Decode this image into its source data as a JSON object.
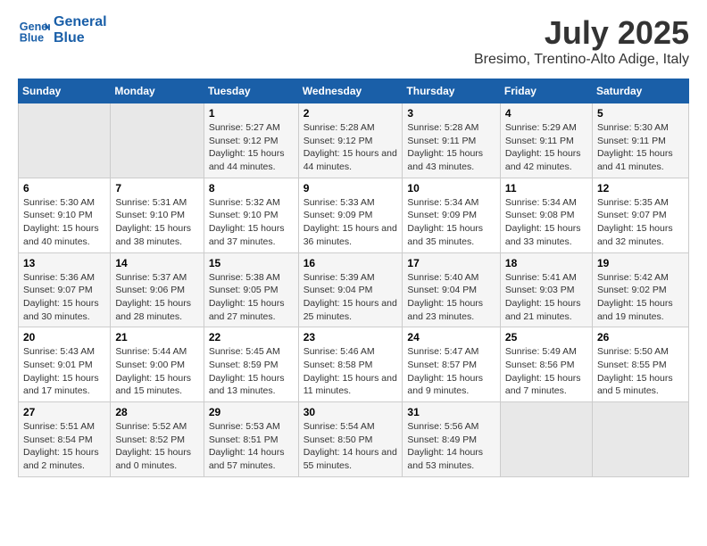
{
  "header": {
    "logo_line1": "General",
    "logo_line2": "Blue",
    "main_title": "July 2025",
    "subtitle": "Bresimo, Trentino-Alto Adige, Italy"
  },
  "days_of_week": [
    "Sunday",
    "Monday",
    "Tuesday",
    "Wednesday",
    "Thursday",
    "Friday",
    "Saturday"
  ],
  "weeks": [
    [
      {
        "day": "",
        "info": ""
      },
      {
        "day": "",
        "info": ""
      },
      {
        "day": "1",
        "info": "Sunrise: 5:27 AM\nSunset: 9:12 PM\nDaylight: 15 hours and 44 minutes."
      },
      {
        "day": "2",
        "info": "Sunrise: 5:28 AM\nSunset: 9:12 PM\nDaylight: 15 hours and 44 minutes."
      },
      {
        "day": "3",
        "info": "Sunrise: 5:28 AM\nSunset: 9:11 PM\nDaylight: 15 hours and 43 minutes."
      },
      {
        "day": "4",
        "info": "Sunrise: 5:29 AM\nSunset: 9:11 PM\nDaylight: 15 hours and 42 minutes."
      },
      {
        "day": "5",
        "info": "Sunrise: 5:30 AM\nSunset: 9:11 PM\nDaylight: 15 hours and 41 minutes."
      }
    ],
    [
      {
        "day": "6",
        "info": "Sunrise: 5:30 AM\nSunset: 9:10 PM\nDaylight: 15 hours and 40 minutes."
      },
      {
        "day": "7",
        "info": "Sunrise: 5:31 AM\nSunset: 9:10 PM\nDaylight: 15 hours and 38 minutes."
      },
      {
        "day": "8",
        "info": "Sunrise: 5:32 AM\nSunset: 9:10 PM\nDaylight: 15 hours and 37 minutes."
      },
      {
        "day": "9",
        "info": "Sunrise: 5:33 AM\nSunset: 9:09 PM\nDaylight: 15 hours and 36 minutes."
      },
      {
        "day": "10",
        "info": "Sunrise: 5:34 AM\nSunset: 9:09 PM\nDaylight: 15 hours and 35 minutes."
      },
      {
        "day": "11",
        "info": "Sunrise: 5:34 AM\nSunset: 9:08 PM\nDaylight: 15 hours and 33 minutes."
      },
      {
        "day": "12",
        "info": "Sunrise: 5:35 AM\nSunset: 9:07 PM\nDaylight: 15 hours and 32 minutes."
      }
    ],
    [
      {
        "day": "13",
        "info": "Sunrise: 5:36 AM\nSunset: 9:07 PM\nDaylight: 15 hours and 30 minutes."
      },
      {
        "day": "14",
        "info": "Sunrise: 5:37 AM\nSunset: 9:06 PM\nDaylight: 15 hours and 28 minutes."
      },
      {
        "day": "15",
        "info": "Sunrise: 5:38 AM\nSunset: 9:05 PM\nDaylight: 15 hours and 27 minutes."
      },
      {
        "day": "16",
        "info": "Sunrise: 5:39 AM\nSunset: 9:04 PM\nDaylight: 15 hours and 25 minutes."
      },
      {
        "day": "17",
        "info": "Sunrise: 5:40 AM\nSunset: 9:04 PM\nDaylight: 15 hours and 23 minutes."
      },
      {
        "day": "18",
        "info": "Sunrise: 5:41 AM\nSunset: 9:03 PM\nDaylight: 15 hours and 21 minutes."
      },
      {
        "day": "19",
        "info": "Sunrise: 5:42 AM\nSunset: 9:02 PM\nDaylight: 15 hours and 19 minutes."
      }
    ],
    [
      {
        "day": "20",
        "info": "Sunrise: 5:43 AM\nSunset: 9:01 PM\nDaylight: 15 hours and 17 minutes."
      },
      {
        "day": "21",
        "info": "Sunrise: 5:44 AM\nSunset: 9:00 PM\nDaylight: 15 hours and 15 minutes."
      },
      {
        "day": "22",
        "info": "Sunrise: 5:45 AM\nSunset: 8:59 PM\nDaylight: 15 hours and 13 minutes."
      },
      {
        "day": "23",
        "info": "Sunrise: 5:46 AM\nSunset: 8:58 PM\nDaylight: 15 hours and 11 minutes."
      },
      {
        "day": "24",
        "info": "Sunrise: 5:47 AM\nSunset: 8:57 PM\nDaylight: 15 hours and 9 minutes."
      },
      {
        "day": "25",
        "info": "Sunrise: 5:49 AM\nSunset: 8:56 PM\nDaylight: 15 hours and 7 minutes."
      },
      {
        "day": "26",
        "info": "Sunrise: 5:50 AM\nSunset: 8:55 PM\nDaylight: 15 hours and 5 minutes."
      }
    ],
    [
      {
        "day": "27",
        "info": "Sunrise: 5:51 AM\nSunset: 8:54 PM\nDaylight: 15 hours and 2 minutes."
      },
      {
        "day": "28",
        "info": "Sunrise: 5:52 AM\nSunset: 8:52 PM\nDaylight: 15 hours and 0 minutes."
      },
      {
        "day": "29",
        "info": "Sunrise: 5:53 AM\nSunset: 8:51 PM\nDaylight: 14 hours and 57 minutes."
      },
      {
        "day": "30",
        "info": "Sunrise: 5:54 AM\nSunset: 8:50 PM\nDaylight: 14 hours and 55 minutes."
      },
      {
        "day": "31",
        "info": "Sunrise: 5:56 AM\nSunset: 8:49 PM\nDaylight: 14 hours and 53 minutes."
      },
      {
        "day": "",
        "info": ""
      },
      {
        "day": "",
        "info": ""
      }
    ]
  ]
}
